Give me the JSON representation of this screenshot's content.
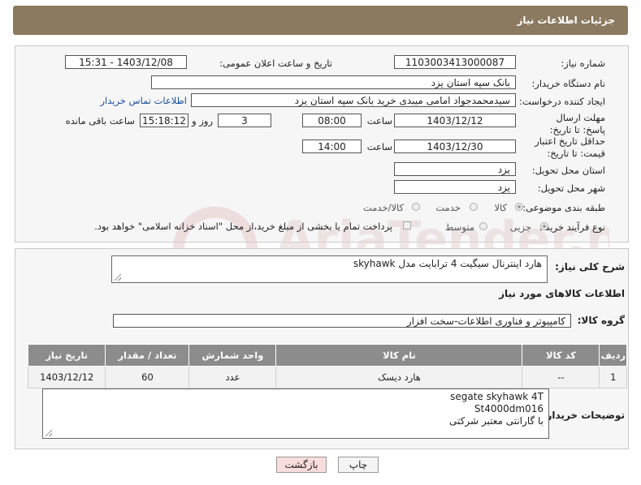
{
  "header": {
    "title": "جزئیات اطلاعات نیاز"
  },
  "fields": {
    "need_number_label": "شماره نیاز:",
    "need_number": "1103003413000087",
    "announce_label": "تاریخ و ساعت اعلان عمومی:",
    "announce_value": "1403/12/08 - 15:31",
    "buyer_org_label": "نام دستگاه خریدار:",
    "buyer_org": "بانک سپه استان یزد",
    "creator_label": "ایجاد کننده درخواست:",
    "creator": "سیدمحمدجواد امامی میبدی خرید   بانک سپه استان یزد",
    "contact_link": "اطلاعات تماس خریدار",
    "reply_deadline_label": "مهلت ارسال پاسخ: تا تاریخ:",
    "reply_date": "1403/12/12",
    "time_label": "ساعت",
    "reply_time": "08:00",
    "days_value": "3",
    "days_label": "روز و",
    "remaining_time": "15:18:12",
    "remaining_label": "ساعت باقی مانده",
    "price_validity_label": "حداقل تاریخ اعتبار قیمت: تا تاریخ:",
    "price_date": "1403/12/30",
    "price_time": "14:00",
    "province_label": "استان محل تحویل:",
    "province": "یزد",
    "city_label": "شهر محل تحویل:",
    "city": "یزد",
    "category_label": "طبقه بندی موضوعی:",
    "category_options": [
      "کالا",
      "خدمت",
      "کالا/خدمت"
    ],
    "purchase_type_label": "نوع فرآیند خرید :",
    "purchase_options": [
      "جزیی",
      "متوسط"
    ],
    "payment_note": "پرداخت تمام یا بخشی از مبلغ خرید،از محل \"اسناد خزانه اسلامی\" خواهد بود."
  },
  "description": {
    "label": "شرح کلی نیاز:",
    "text": "هارد اینترنال سیگیت 4 ترابایت مدل skyhawk"
  },
  "goods_section": {
    "title": "اطلاعات کالاهای مورد نیاز"
  },
  "goods_group": {
    "label": "گروه کالا:",
    "value": "کامپیوتر و فناوری اطلاعات-سخت افزار"
  },
  "table": {
    "headers": [
      "ردیف",
      "کد کالا",
      "نام کالا",
      "واحد شمارش",
      "تعداد / مقدار",
      "تاریخ نیاز"
    ],
    "rows": [
      [
        "1",
        "--",
        "هارد دیسک",
        "عدد",
        "60",
        "1403/12/12"
      ]
    ]
  },
  "buyer_notes": {
    "label": "توضیحات خریدار:",
    "lines": [
      "segate skyhawk 4T",
      "St4000dm016",
      "با گارانتی معتبر شرکتی"
    ]
  },
  "buttons": {
    "print": "چاپ",
    "back": "بازگشت"
  },
  "watermark": {
    "text": "AriaTender.neT"
  },
  "colors": {
    "header": "#8c7a60",
    "table_header": "#8c8c8c",
    "link": "#1a4fa0",
    "back_button": "#f9dcdc"
  }
}
